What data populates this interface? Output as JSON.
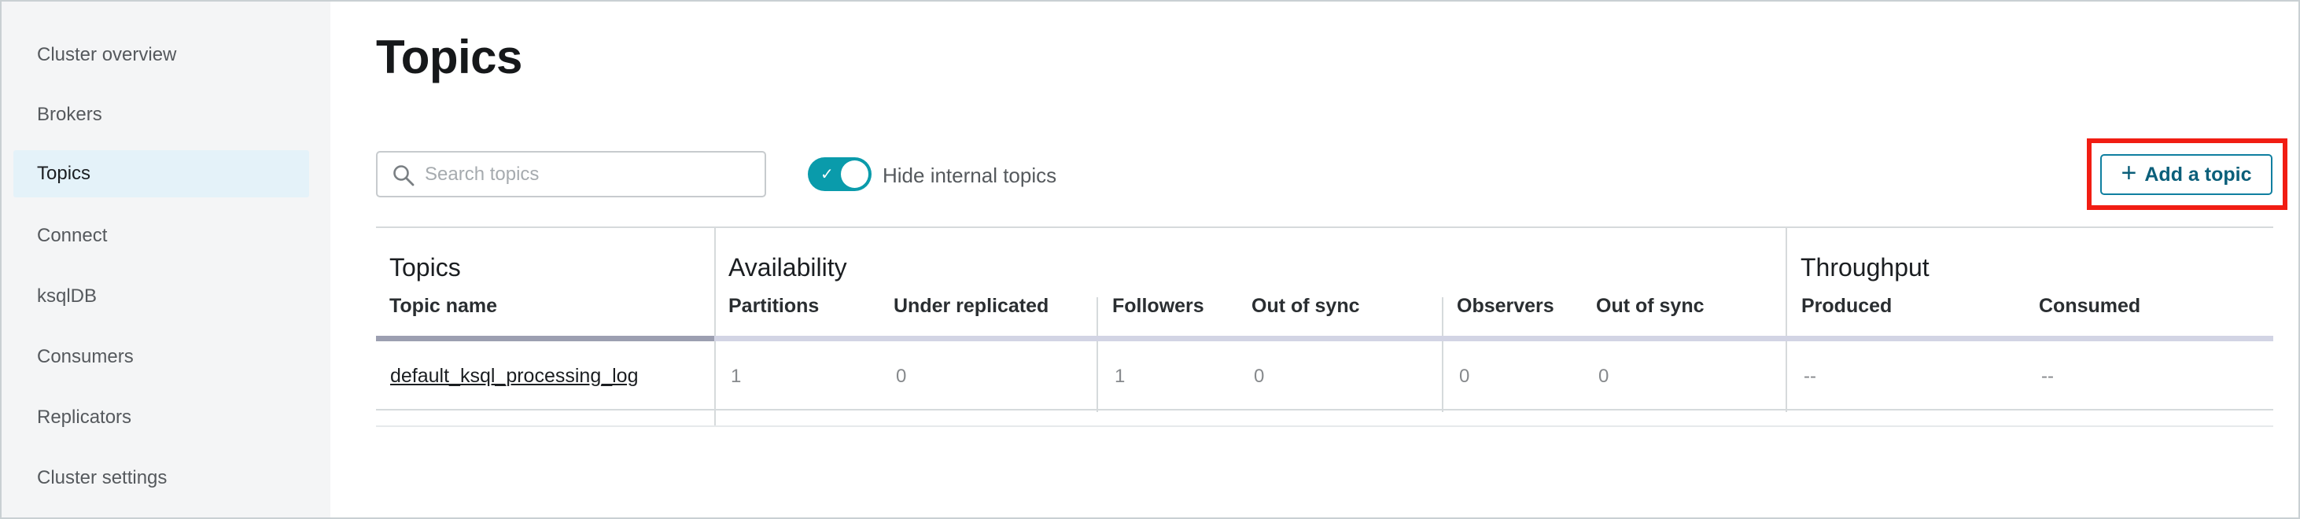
{
  "sidebar": {
    "items": [
      {
        "label": "Cluster overview",
        "active": false
      },
      {
        "label": "Brokers",
        "active": false
      },
      {
        "label": "Topics",
        "active": true
      },
      {
        "label": "Connect",
        "active": false
      },
      {
        "label": "ksqlDB",
        "active": false
      },
      {
        "label": "Consumers",
        "active": false
      },
      {
        "label": "Replicators",
        "active": false
      },
      {
        "label": "Cluster settings",
        "active": false
      }
    ]
  },
  "page": {
    "title": "Topics"
  },
  "toolbar": {
    "search_placeholder": "Search topics",
    "search_value": "",
    "hide_internal_label": "Hide internal topics",
    "hide_internal_on": true,
    "add_topic_label": "Add a topic"
  },
  "table": {
    "groups": {
      "topics": "Topics",
      "availability": "Availability",
      "throughput": "Throughput"
    },
    "columns": {
      "topic_name": "Topic name",
      "partitions": "Partitions",
      "under_replicated": "Under replicated",
      "followers": "Followers",
      "followers_out_of_sync": "Out of sync",
      "observers": "Observers",
      "observers_out_of_sync": "Out of sync",
      "produced": "Produced",
      "consumed": "Consumed"
    },
    "rows": [
      {
        "topic_name": "default_ksql_processing_log",
        "partitions": "1",
        "under_replicated": "0",
        "followers": "1",
        "followers_out_of_sync": "0",
        "observers": "0",
        "observers_out_of_sync": "0",
        "produced": "--",
        "consumed": "--"
      }
    ]
  },
  "colors": {
    "accent": "#0a9bab",
    "link": "#0b5f7a",
    "highlight": "#f11d13",
    "sidebar_active": "#e4f2f9"
  },
  "icons": {
    "search": "search-icon",
    "toggle_check": "check-icon",
    "add": "plus-icon"
  }
}
